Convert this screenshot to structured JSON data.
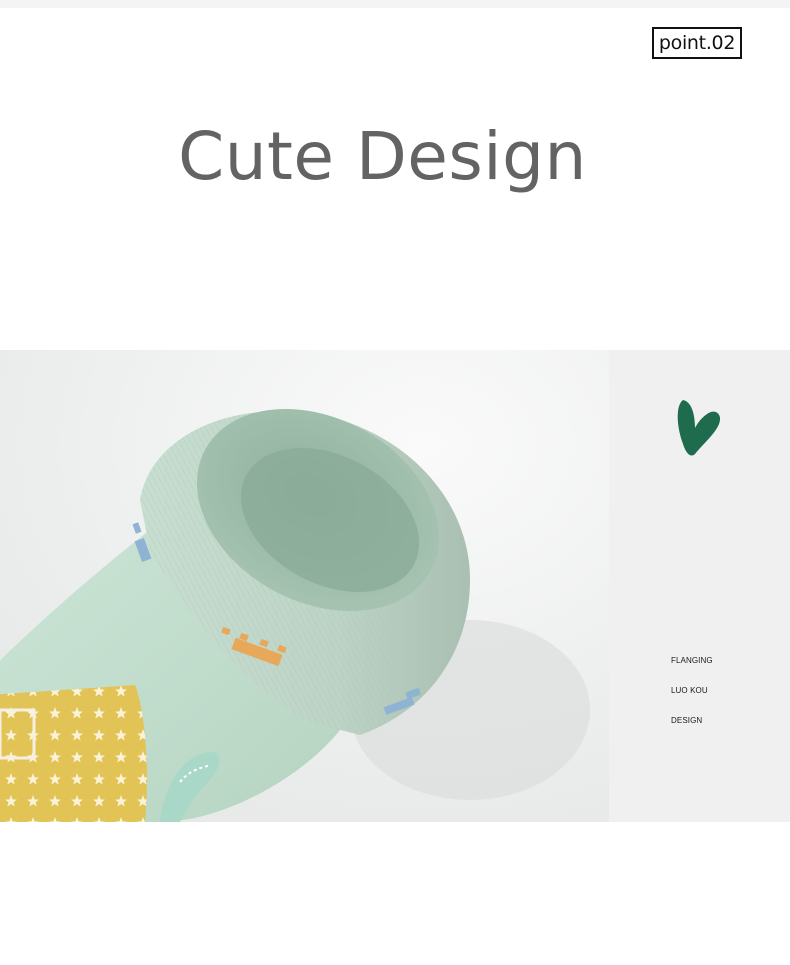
{
  "badge": {
    "label": "point.02"
  },
  "headline": {
    "title": "Cute Design"
  },
  "side_panel": {
    "icon": "heart-icon",
    "heart_color": "#1e6b4e",
    "lines": [
      "FLANGING",
      "LUO KOU",
      "DESIGN"
    ]
  },
  "photo": {
    "subject": "sock-photo"
  },
  "colors": {
    "sock_green": "#b9d9c8",
    "cuff_green": "#c4dccd",
    "yellow_patch": "#e5c657",
    "headline_gray": "#636363"
  }
}
